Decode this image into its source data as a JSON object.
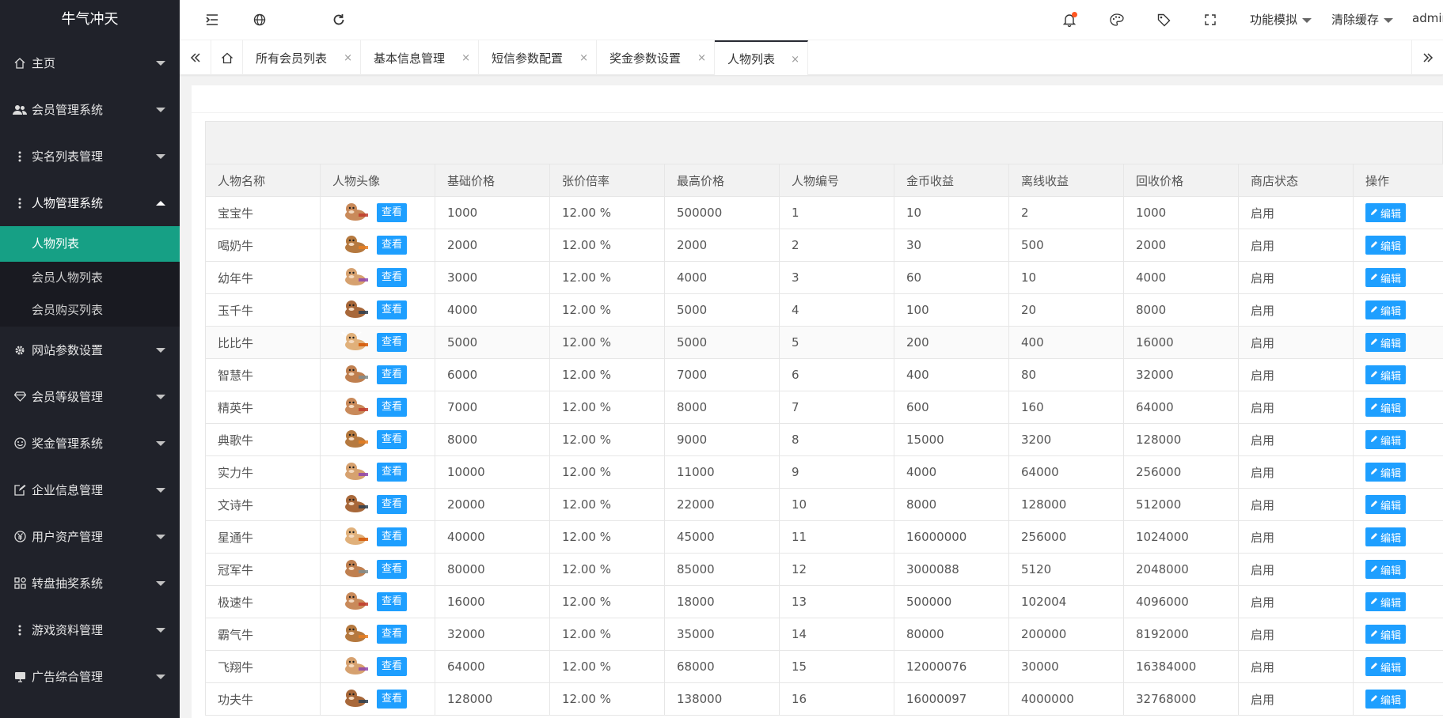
{
  "app": {
    "logo": "牛气冲天"
  },
  "sidebar": {
    "items_top": [
      {
        "label": "主页",
        "icon": "home-icon"
      },
      {
        "label": "会员管理系统",
        "icon": "users-icon"
      },
      {
        "label": "实名列表管理",
        "icon": "dots-icon"
      }
    ],
    "expanded": {
      "label": "人物管理系统",
      "icon": "dots-icon",
      "children": [
        {
          "label": "人物列表",
          "active": true
        },
        {
          "label": "会员人物列表"
        },
        {
          "label": "会员购买列表"
        }
      ]
    },
    "items_bottom": [
      {
        "label": "网站参数设置",
        "icon": "gear-icon"
      },
      {
        "label": "会员等级管理",
        "icon": "diamond-icon"
      },
      {
        "label": "奖金管理系统",
        "icon": "smile-icon"
      },
      {
        "label": "企业信息管理",
        "icon": "edit-doc-icon"
      },
      {
        "label": "用户资产管理",
        "icon": "yen-icon"
      },
      {
        "label": "转盘抽奖系统",
        "icon": "apps-icon"
      },
      {
        "label": "游戏资料管理",
        "icon": "dots-icon"
      },
      {
        "label": "广告综合管理",
        "icon": "monitor-icon"
      }
    ]
  },
  "header": {
    "function_sim": "功能模拟",
    "clear_cache": "清除缓存",
    "user": "admin"
  },
  "tabs": [
    {
      "label": "所有会员列表",
      "close": "×"
    },
    {
      "label": "基本信息管理",
      "close": "×"
    },
    {
      "label": "短信参数配置",
      "close": "×"
    },
    {
      "label": "奖金参数设置",
      "close": "×"
    },
    {
      "label": "人物列表",
      "close": "×",
      "active": true
    }
  ],
  "table": {
    "columns": [
      "人物名称",
      "人物头像",
      "基础价格",
      "张价倍率",
      "最高价格",
      "人物编号",
      "金币收益",
      "离线收益",
      "回收价格",
      "商店状态",
      "操作"
    ],
    "view_label": "查看",
    "edit_label": "编辑",
    "rows": [
      {
        "name": "宝宝牛",
        "base": "1000",
        "rate": "12.00 %",
        "max": "500000",
        "no": "1",
        "gold": "10",
        "offline": "2",
        "recycle": "1000",
        "status": "启用"
      },
      {
        "name": "喝奶牛",
        "base": "2000",
        "rate": "12.00 %",
        "max": "2000",
        "no": "2",
        "gold": "30",
        "offline": "500",
        "recycle": "2000",
        "status": "启用"
      },
      {
        "name": "幼年牛",
        "base": "3000",
        "rate": "12.00 %",
        "max": "4000",
        "no": "3",
        "gold": "60",
        "offline": "10",
        "recycle": "4000",
        "status": "启用"
      },
      {
        "name": "玉千牛",
        "base": "4000",
        "rate": "12.00 %",
        "max": "5000",
        "no": "4",
        "gold": "100",
        "offline": "20",
        "recycle": "8000",
        "status": "启用"
      },
      {
        "name": "比比牛",
        "base": "5000",
        "rate": "12.00 %",
        "max": "5000",
        "no": "5",
        "gold": "200",
        "offline": "400",
        "recycle": "16000",
        "status": "启用"
      },
      {
        "name": "智慧牛",
        "base": "6000",
        "rate": "12.00 %",
        "max": "7000",
        "no": "6",
        "gold": "400",
        "offline": "80",
        "recycle": "32000",
        "status": "启用"
      },
      {
        "name": "精英牛",
        "base": "7000",
        "rate": "12.00 %",
        "max": "8000",
        "no": "7",
        "gold": "600",
        "offline": "160",
        "recycle": "64000",
        "status": "启用"
      },
      {
        "name": "典歌牛",
        "base": "8000",
        "rate": "12.00 %",
        "max": "9000",
        "no": "8",
        "gold": "15000",
        "offline": "3200",
        "recycle": "128000",
        "status": "启用"
      },
      {
        "name": "实力牛",
        "base": "10000",
        "rate": "12.00 %",
        "max": "11000",
        "no": "9",
        "gold": "4000",
        "offline": "64000",
        "recycle": "256000",
        "status": "启用"
      },
      {
        "name": "文诗牛",
        "base": "20000",
        "rate": "12.00 %",
        "max": "22000",
        "no": "10",
        "gold": "8000",
        "offline": "128000",
        "recycle": "512000",
        "status": "启用"
      },
      {
        "name": "星通牛",
        "base": "40000",
        "rate": "12.00 %",
        "max": "45000",
        "no": "11",
        "gold": "16000000",
        "offline": "256000",
        "recycle": "1024000",
        "status": "启用"
      },
      {
        "name": "冠军牛",
        "base": "80000",
        "rate": "12.00 %",
        "max": "85000",
        "no": "12",
        "gold": "3000088",
        "offline": "5120",
        "recycle": "2048000",
        "status": "启用"
      },
      {
        "name": "极速牛",
        "base": "16000",
        "rate": "12.00 %",
        "max": "18000",
        "no": "13",
        "gold": "500000",
        "offline": "102004",
        "recycle": "4096000",
        "status": "启用"
      },
      {
        "name": "霸气牛",
        "base": "32000",
        "rate": "12.00 %",
        "max": "35000",
        "no": "14",
        "gold": "80000",
        "offline": "200000",
        "recycle": "8192000",
        "status": "启用"
      },
      {
        "name": "飞翔牛",
        "base": "64000",
        "rate": "12.00 %",
        "max": "68000",
        "no": "15",
        "gold": "12000076",
        "offline": "30000",
        "recycle": "16384000",
        "status": "启用"
      },
      {
        "name": "功夫牛",
        "base": "128000",
        "rate": "12.00 %",
        "max": "138000",
        "no": "16",
        "gold": "16000097",
        "offline": "4000000",
        "recycle": "32768000",
        "status": "启用"
      }
    ]
  },
  "colors": {
    "sidebar_bg": "#20222a",
    "active_menu": "#16a085",
    "primary_button": "#1e9fff",
    "notify_dot": "#ff5722"
  }
}
